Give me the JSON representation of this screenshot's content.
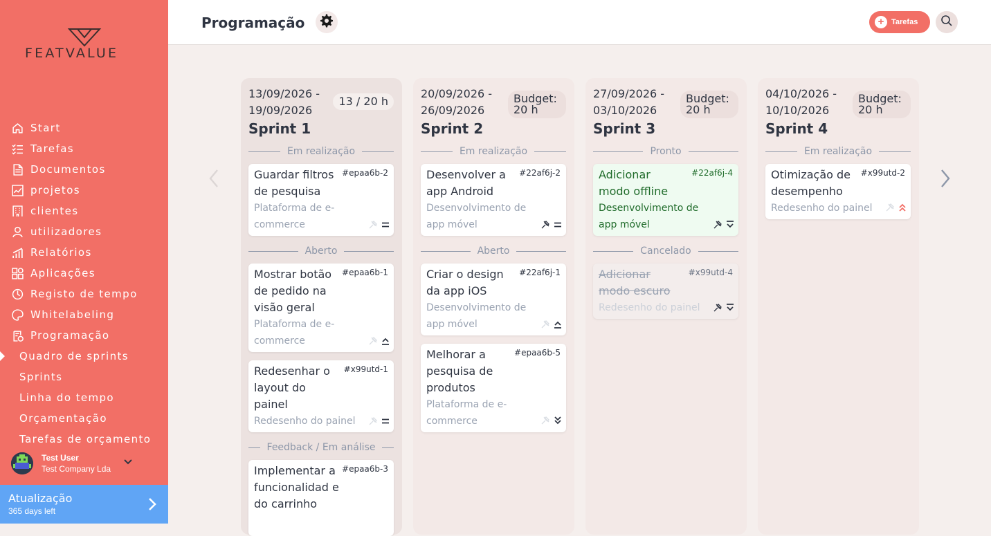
{
  "brand": {
    "name": "FEATVALUE",
    "accent": "#f26f66",
    "upgrade_color": "#60a5f5"
  },
  "sidebar": {
    "items": [
      {
        "label": "Start",
        "icon": "home-icon"
      },
      {
        "label": "Tarefas",
        "icon": "checklist-icon"
      },
      {
        "label": "Documentos",
        "icon": "document-icon"
      },
      {
        "label": "projetos",
        "icon": "chart-icon"
      },
      {
        "label": "clientes",
        "icon": "building-icon"
      },
      {
        "label": "utilizadores",
        "icon": "user-icon"
      },
      {
        "label": "Relatórios",
        "icon": "bar-chart-icon"
      },
      {
        "label": "Aplicações",
        "icon": "apps-icon"
      },
      {
        "label": "Registo de tempo",
        "icon": "timer-icon"
      },
      {
        "label": "Whitelabeling",
        "icon": "palette-icon"
      },
      {
        "label": "Programação",
        "icon": "schedule-icon"
      }
    ],
    "subitems": [
      {
        "label": "Quadro de sprints",
        "active": true
      },
      {
        "label": "Sprints"
      },
      {
        "label": "Linha do tempo"
      },
      {
        "label": "Orçamentação"
      },
      {
        "label": "Tarefas de orçamento"
      }
    ],
    "user": {
      "name": "Test User",
      "company": "Test Company Lda"
    },
    "upgrade": {
      "title": "Atualização",
      "subtitle": "365 days left"
    }
  },
  "header": {
    "title": "Programação",
    "tasks_button": "Tarefas"
  },
  "columns": [
    {
      "dates": "13/09/2026 - 19/09/2026",
      "badge": "13 / 20 h",
      "title": "Sprint 1",
      "groups": [
        {
          "label": "Em realização",
          "cards": [
            {
              "title": "Guardar filtros de pesquisa",
              "id": "#epaa6b-2",
              "project": "Plataforma de e-commerce",
              "priority": "medium"
            }
          ]
        },
        {
          "label": "Aberto",
          "cards": [
            {
              "title": "Mostrar botão de pedido na visão geral",
              "id": "#epaa6b-1",
              "project": "Plataforma de e-commerce",
              "priority": "high"
            },
            {
              "title": "Redesenhar o layout do painel",
              "id": "#x99utd-1",
              "project": "Redesenho do painel",
              "priority": "medium"
            }
          ]
        },
        {
          "label": "Feedback / Em análise",
          "cards": [
            {
              "title": "Implementar a funcionalidad e do carrinho",
              "id": "#epaa6b-3",
              "project": "",
              "priority": ""
            }
          ]
        }
      ]
    },
    {
      "dates": "20/09/2026 - 26/09/2026",
      "badge": "Budget: 20 h",
      "title": "Sprint 2",
      "groups": [
        {
          "label": "Em realização",
          "cards": [
            {
              "title": "Desenvolver a app Android",
              "id": "#22af6j-2",
              "project": "Desenvolvimento de app móvel",
              "priority": "medium"
            }
          ]
        },
        {
          "label": "Aberto",
          "cards": [
            {
              "title": "Criar o design da app iOS",
              "id": "#22af6j-1",
              "project": "Desenvolvimento de app móvel",
              "priority": "high"
            },
            {
              "title": "Melhorar a pesquisa de produtos",
              "id": "#epaa6b-5",
              "project": "Plataforma de e-commerce",
              "priority": "lowest"
            }
          ]
        }
      ]
    },
    {
      "dates": "27/09/2026 - 03/10/2026",
      "badge": "Budget: 20 h",
      "title": "Sprint 3",
      "groups": [
        {
          "label": "Pronto",
          "cards": [
            {
              "title": "Adicionar modo offline",
              "id": "#22af6j-4",
              "project": "Desenvolvimento de app móvel",
              "priority": "low",
              "state": "done"
            }
          ]
        },
        {
          "label": "Cancelado",
          "cards": [
            {
              "title": "Adicionar modo escuro",
              "id": "#x99utd-4",
              "project": "Redesenho do painel",
              "priority": "low",
              "state": "cancelled"
            }
          ]
        }
      ]
    },
    {
      "dates": "04/10/2026 - 10/10/2026",
      "badge": "Budget: 20 h",
      "title": "Sprint 4",
      "groups": [
        {
          "label": "Em realização",
          "cards": [
            {
              "title": "Otimização de desempenho",
              "id": "#x99utd-2",
              "project": "Redesenho do painel",
              "priority": "highest"
            }
          ]
        }
      ]
    }
  ]
}
